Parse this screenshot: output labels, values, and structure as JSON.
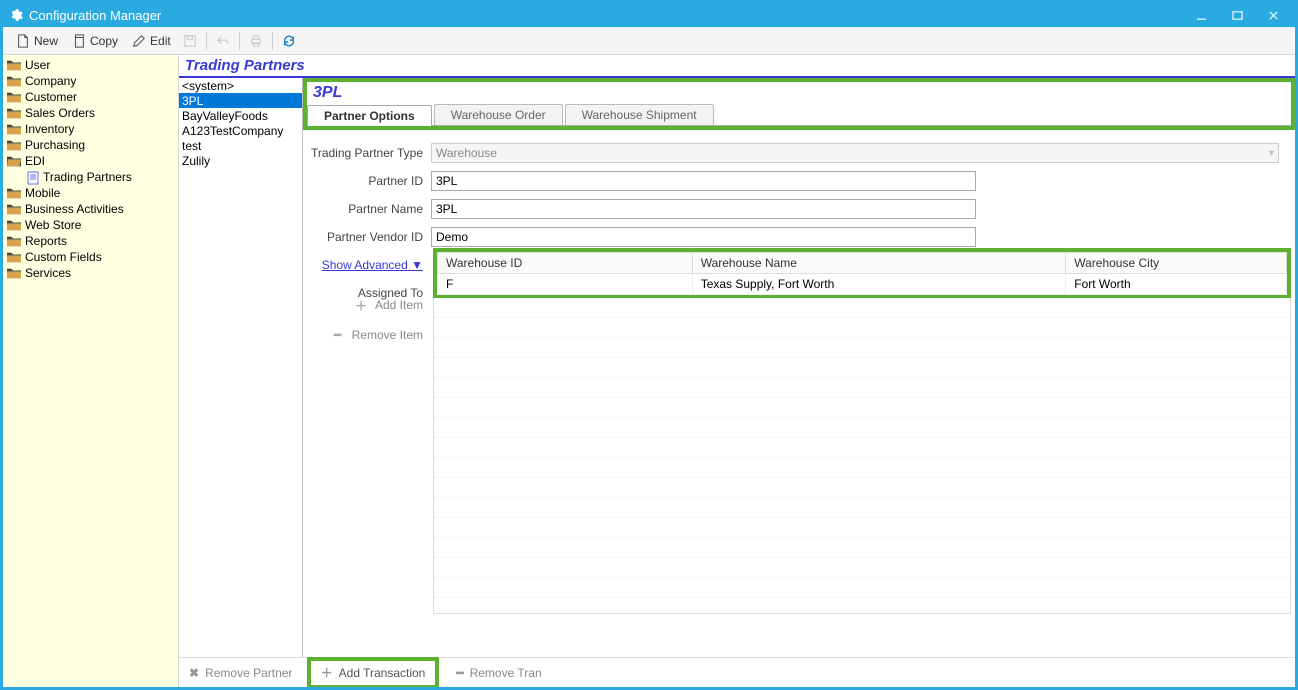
{
  "window": {
    "title": "Configuration Manager"
  },
  "toolbar": {
    "new_label": "New",
    "copy_label": "Copy",
    "edit_label": "Edit"
  },
  "nav": {
    "items": [
      {
        "label": "User",
        "type": "folder"
      },
      {
        "label": "Company",
        "type": "folder"
      },
      {
        "label": "Customer",
        "type": "folder"
      },
      {
        "label": "Sales Orders",
        "type": "folder"
      },
      {
        "label": "Inventory",
        "type": "folder"
      },
      {
        "label": "Purchasing",
        "type": "folder"
      },
      {
        "label": "EDI",
        "type": "folder-open",
        "children": [
          {
            "label": "Trading Partners",
            "type": "doc",
            "selected": true
          }
        ]
      },
      {
        "label": "Mobile",
        "type": "folder"
      },
      {
        "label": "Business Activities",
        "type": "folder"
      },
      {
        "label": "Web Store",
        "type": "folder"
      },
      {
        "label": "Reports",
        "type": "folder"
      },
      {
        "label": "Custom Fields",
        "type": "folder"
      },
      {
        "label": "Services",
        "type": "folder"
      }
    ]
  },
  "page": {
    "title": "Trading Partners"
  },
  "partners": {
    "items": [
      {
        "label": "<system>"
      },
      {
        "label": "3PL",
        "selected": true
      },
      {
        "label": "BayValleyFoods"
      },
      {
        "label": "A123TestCompany"
      },
      {
        "label": "test"
      },
      {
        "label": "Zulily"
      }
    ]
  },
  "detail": {
    "title": "3PL",
    "tabs": [
      {
        "label": "Partner Options",
        "active": true
      },
      {
        "label": "Warehouse Order"
      },
      {
        "label": "Warehouse Shipment"
      }
    ],
    "fields": {
      "trading_partner_type_label": "Trading Partner Type",
      "trading_partner_type_value": "Warehouse",
      "partner_id_label": "Partner ID",
      "partner_id_value": "3PL",
      "partner_name_label": "Partner Name",
      "partner_name_value": "3PL",
      "partner_vendor_id_label": "Partner Vendor ID",
      "partner_vendor_id_value": "Demo"
    },
    "show_advanced_label": "Show Advanced ▼",
    "assigned_to_label": "Assigned To",
    "add_item_label": "Add Item",
    "remove_item_label": "Remove Item",
    "grid": {
      "columns": [
        "Warehouse ID",
        "Warehouse Name",
        "Warehouse City"
      ],
      "rows": [
        {
          "id": "F",
          "name": "Texas Supply, Fort Worth",
          "city": "Fort Worth"
        }
      ]
    }
  },
  "bottom": {
    "remove_partner_label": "Remove Partner",
    "add_transaction_label": "Add Transaction",
    "remove_tran_label": "Remove Tran"
  }
}
